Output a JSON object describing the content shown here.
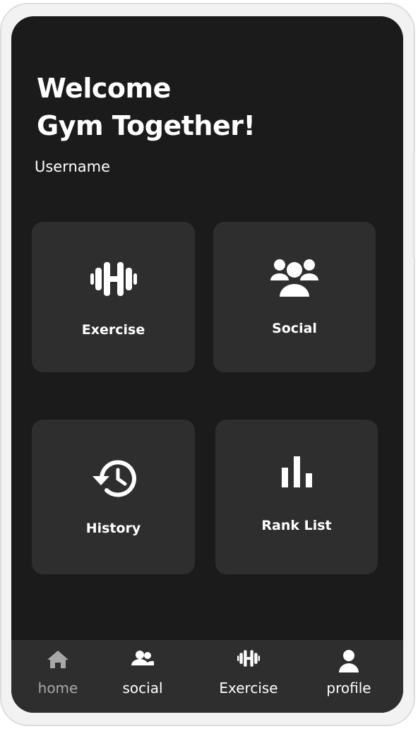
{
  "header": {
    "title_line1": "Welcome",
    "title_line2": "Gym Together!",
    "username": "Username"
  },
  "cards": [
    {
      "label": "Exercise",
      "icon": "dumbbell-icon"
    },
    {
      "label": "Social",
      "icon": "group-icon"
    },
    {
      "label": "History",
      "icon": "history-icon"
    },
    {
      "label": "Rank List",
      "icon": "bar-chart-icon"
    }
  ],
  "bottom_nav": {
    "active": "home",
    "items": [
      {
        "label": "home",
        "icon": "home-icon"
      },
      {
        "label": "social",
        "icon": "people-icon"
      },
      {
        "label": "Exercise",
        "icon": "dumbbell-icon"
      },
      {
        "label": "profile",
        "icon": "person-icon"
      }
    ]
  },
  "colors": {
    "background": "#1b1b1b",
    "card": "#2e2e2e",
    "text": "#ffffff",
    "nav_active": "#a8a8a8",
    "frame": "#f2f2f2"
  }
}
